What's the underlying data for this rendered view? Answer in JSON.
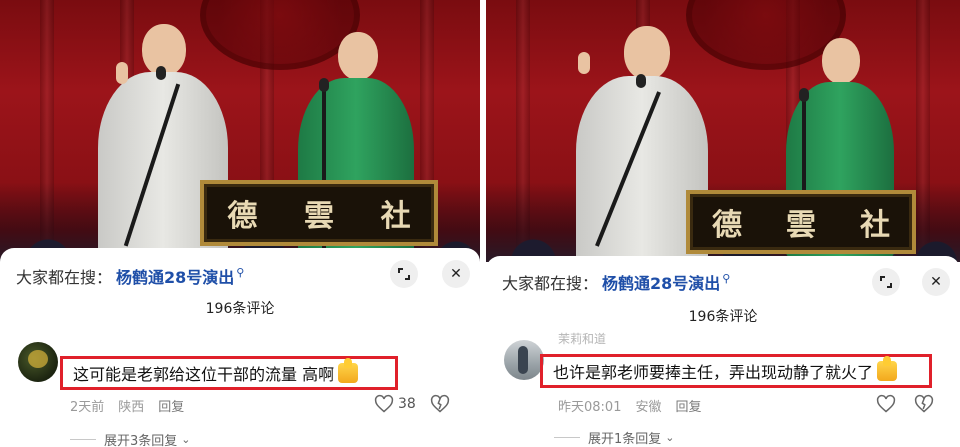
{
  "panels": [
    {
      "search_prefix": "大家都在搜：",
      "search_term": "杨鹤通28号演出",
      "search_icon": "search-icon",
      "expand_icon": "expand-icon",
      "close_icon": "close-icon",
      "comment_count": "196条评论",
      "comment": {
        "username": "",
        "text": "这可能是老郭给这位干部的流量 高啊",
        "emoji": "thumbs-up-emoji",
        "time": "2天前",
        "location": "陕西",
        "reply_label": "回复",
        "like_count": "38",
        "expand_replies": "展开3条回复"
      },
      "plaque": [
        "德",
        "雲",
        "社"
      ]
    },
    {
      "search_prefix": "大家都在搜：",
      "search_term": "杨鹤通28号演出",
      "search_icon": "search-icon",
      "expand_icon": "expand-icon",
      "close_icon": "close-icon",
      "comment_count": "196条评论",
      "comment": {
        "username": "茉莉和道",
        "text": "也许是郭老师要捧主任，弄出现动静了就火了",
        "emoji": "thumbs-up-emoji",
        "time": "昨天08:01",
        "location": "安徽",
        "reply_label": "回复",
        "like_count": "",
        "expand_replies": "展开1条回复"
      },
      "plaque": [
        "德",
        "雲",
        "社"
      ]
    }
  ],
  "colors": {
    "highlight_border": "#e0202a",
    "search_term": "#1f4fa8",
    "curtain": "#9c141a"
  }
}
